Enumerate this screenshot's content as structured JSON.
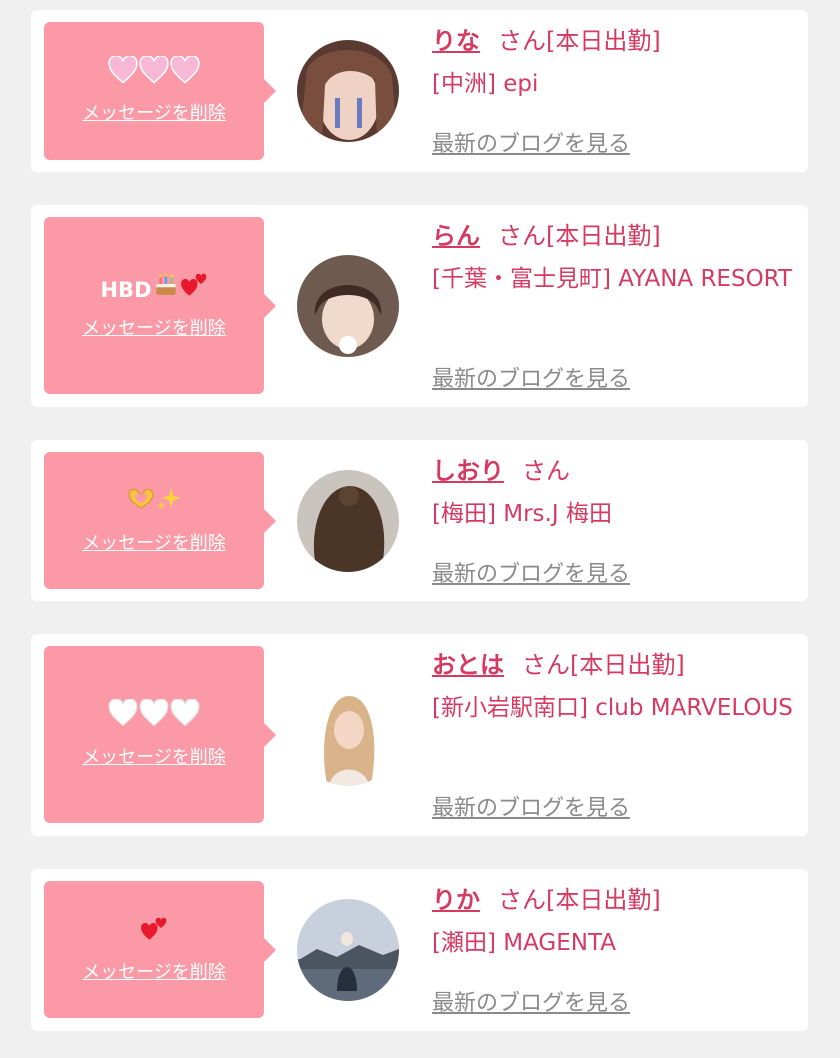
{
  "colors": {
    "page_bg": "#f0f0f0",
    "card_bg": "#ffffff",
    "message_bubble": "#fb9aa6",
    "name_pink": "#d63a62",
    "blog_link_gray": "#8a8a8a"
  },
  "cards": [
    {
      "message_icons": [
        "pink-heart-icon",
        "pink-heart-icon",
        "pink-heart-icon"
      ],
      "message_text": "",
      "delete_label": "メッセージを削除",
      "name": "りな",
      "suffix": "さん[本日出勤]",
      "shop": "[中洲] epi",
      "blog_label": "最新のブログを見る"
    },
    {
      "message_icons": [
        "birthday-cake-icon",
        "two-hearts-icon"
      ],
      "message_text": "HBD",
      "delete_label": "メッセージを削除",
      "name": "らん",
      "suffix": "さん[本日出勤]",
      "shop": "[千葉・富士見町] AYANA RESORT",
      "blog_label": "最新のブログを見る"
    },
    {
      "message_icons": [
        "heart-hands-icon",
        "sparkles-icon"
      ],
      "message_text": "",
      "delete_label": "メッセージを削除",
      "name": "しおり",
      "suffix": "さん",
      "shop": "[梅田] Mrs.J 梅田",
      "blog_label": "最新のブログを見る"
    },
    {
      "message_icons": [
        "white-heart-icon",
        "white-heart-icon",
        "white-heart-icon"
      ],
      "message_text": "",
      "delete_label": "メッセージを削除",
      "name": "おとは",
      "suffix": "さん[本日出勤]",
      "shop": "[新小岩駅南口] club MARVELOUS",
      "blog_label": "最新のブログを見る"
    },
    {
      "message_icons": [
        "two-hearts-icon"
      ],
      "message_text": "",
      "delete_label": "メッセージを削除",
      "name": "りか",
      "suffix": "さん[本日出勤]",
      "shop": "[瀬田] MAGENTA",
      "blog_label": "最新のブログを見る"
    }
  ]
}
